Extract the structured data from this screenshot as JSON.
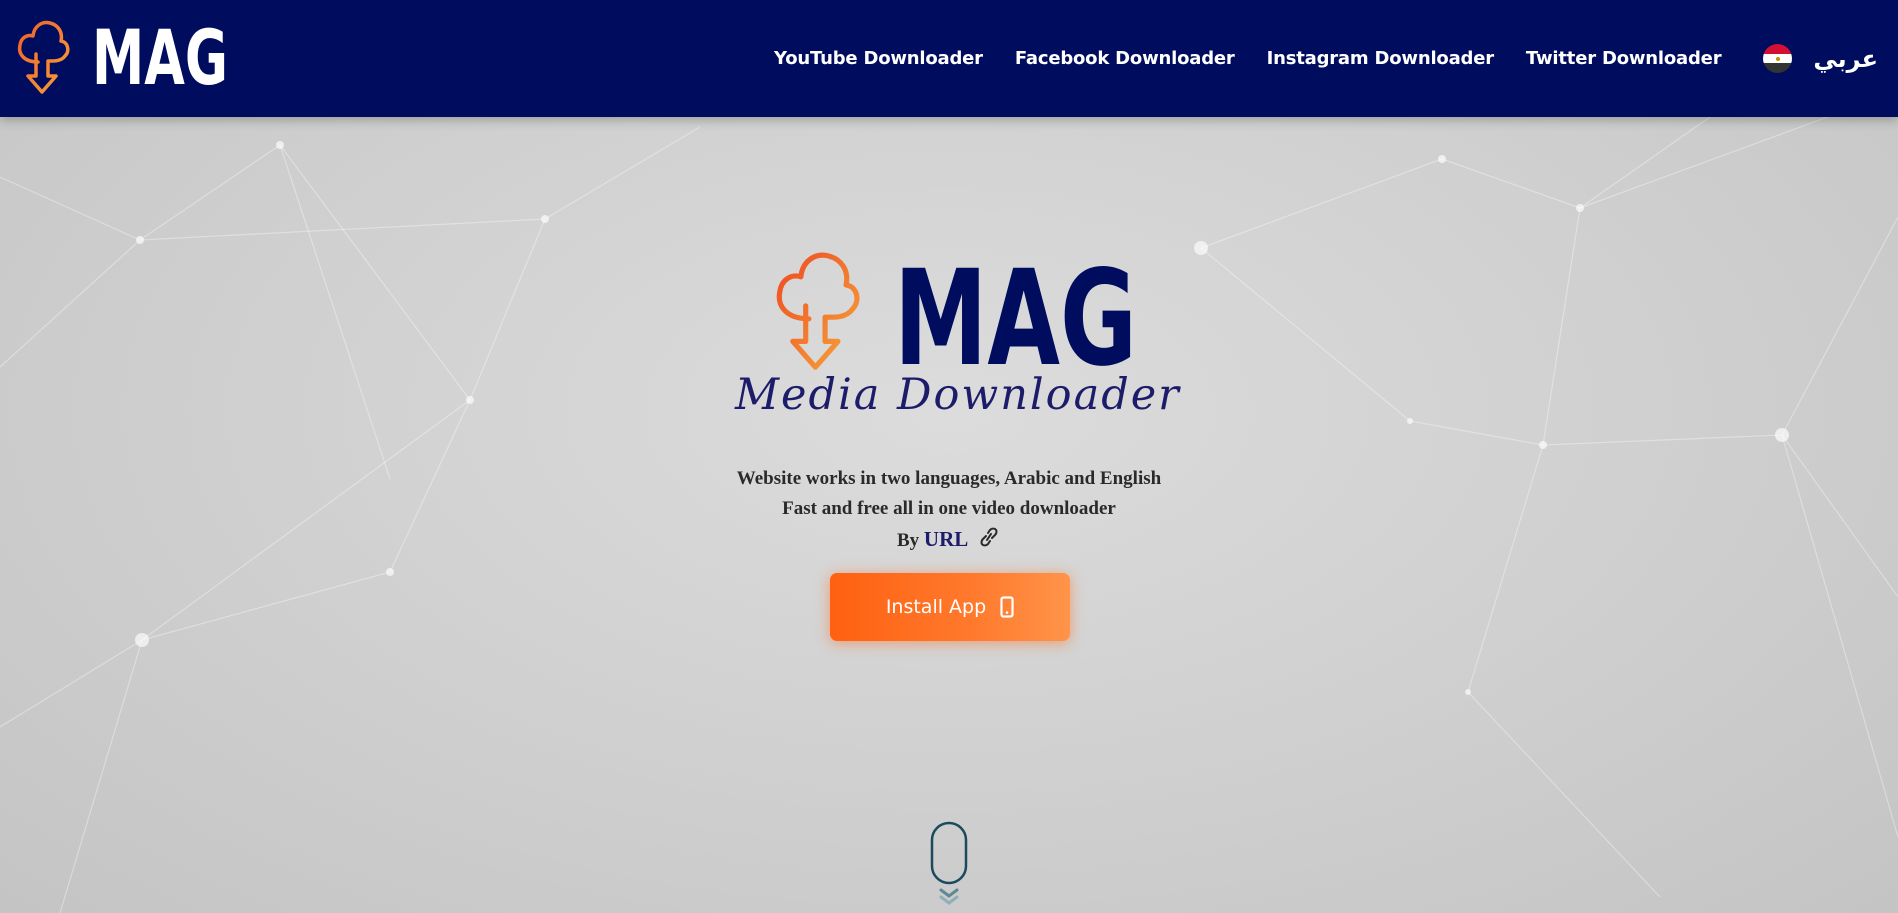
{
  "header": {
    "brand_text": "MAG",
    "nav": [
      {
        "label": "YouTube Downloader"
      },
      {
        "label": "Facebook Downloader"
      },
      {
        "label": "Instagram Downloader"
      },
      {
        "label": "Twitter Downloader"
      }
    ],
    "language": {
      "label": "عربي",
      "flag": "egypt-flag-icon"
    }
  },
  "hero": {
    "logo_text": "MAG",
    "logo_tagline": "Media Downloader",
    "line1": "Website works in two languages, Arabic and English",
    "line2": "Fast and free all in one video downloader",
    "by_prefix": "By",
    "url_label": "URL",
    "link_icon": "link-icon",
    "install_label": "Install App",
    "install_icon": "mobile-phone-icon",
    "scroll_icon": "scroll-down-mouse-icon"
  },
  "colors": {
    "header_bg": "#000c5e",
    "brand_navy": "#000c5e",
    "accent_orange": "#ff6a1a",
    "tagline": "#1d1c6a",
    "page_bg": "#d0d0d0",
    "scroll_hint": "#1a4a5c"
  }
}
